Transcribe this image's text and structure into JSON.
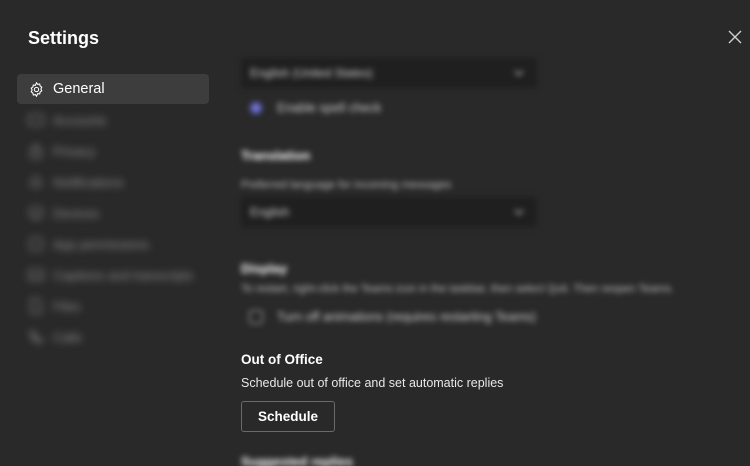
{
  "dialog": {
    "title": "Settings",
    "close_icon": "close-icon"
  },
  "nav": {
    "items": [
      {
        "label": "General",
        "icon": "gear-icon",
        "active": true
      },
      {
        "label": "Accounts",
        "icon": "accounts-icon"
      },
      {
        "label": "Privacy",
        "icon": "lock-icon"
      },
      {
        "label": "Notifications",
        "icon": "bell-icon"
      },
      {
        "label": "Devices",
        "icon": "device-icon"
      },
      {
        "label": "App permissions",
        "icon": "permissions-icon"
      },
      {
        "label": "Captions and transcripts",
        "icon": "captions-icon"
      },
      {
        "label": "Files",
        "icon": "file-icon"
      },
      {
        "label": "Calls",
        "icon": "phone-icon"
      }
    ]
  },
  "content": {
    "language_select": "English (United States)",
    "spell_check_label": "Enable spell check",
    "translation_head": "Translation",
    "translation_desc": "Preferred language for incoming messages",
    "translation_select": "English",
    "display_head": "Display",
    "display_desc": "To restart, right-click the Teams icon in the taskbar, then select Quit. Then reopen Teams.",
    "animations_label": "Turn off animations (requires restarting Teams)",
    "ooo_title": "Out of Office",
    "ooo_desc": "Schedule out of office and set automatic replies",
    "schedule_button": "Schedule",
    "suggested_head": "Suggested replies"
  },
  "colors": {
    "background": "#292929",
    "nav_active": "#3d3d3d",
    "accent": "#7377d6"
  }
}
